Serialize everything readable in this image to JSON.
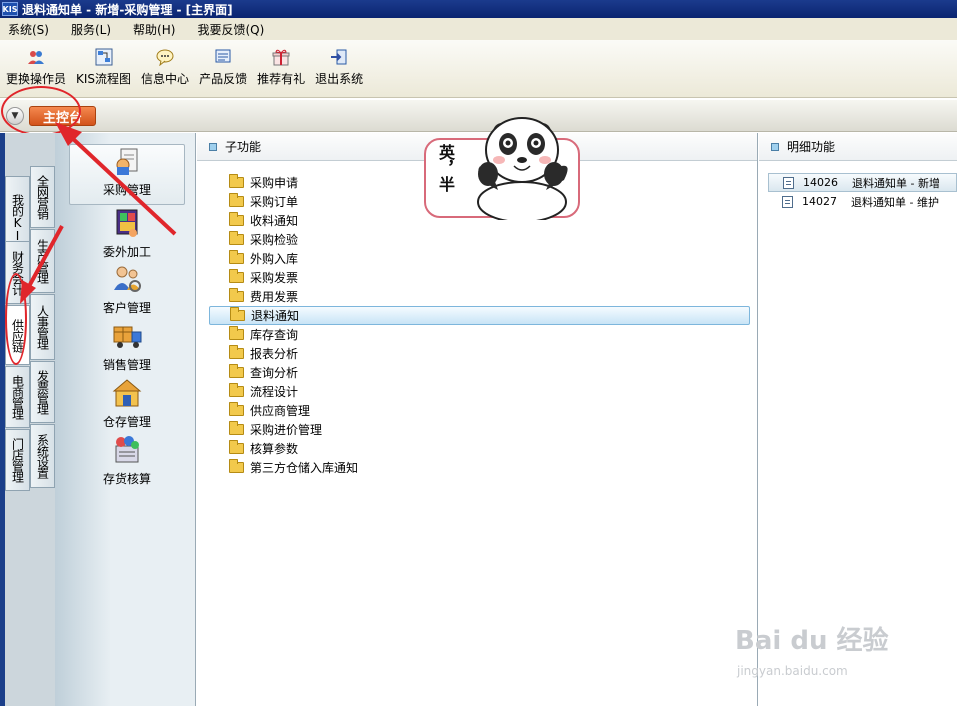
{
  "window": {
    "logo": "KIS",
    "title": "退料通知单 - 新增-采购管理 - [主界面]"
  },
  "menu": [
    "系统(S)",
    "服务(L)",
    "帮助(H)",
    "我要反馈(Q)"
  ],
  "toolbar": [
    {
      "label": "更换操作员",
      "icon": "operator-icon"
    },
    {
      "label": "KIS流程图",
      "icon": "flowchart-icon"
    },
    {
      "label": "信息中心",
      "icon": "message-icon"
    },
    {
      "label": "产品反馈",
      "icon": "feedback-icon"
    },
    {
      "label": "推荐有礼",
      "icon": "gift-icon"
    },
    {
      "label": "退出系统",
      "icon": "exit-icon"
    }
  ],
  "tabs": {
    "main": "主控台"
  },
  "vertical_tabs": [
    {
      "label": "我的KIS"
    },
    {
      "label": "全网营销"
    },
    {
      "label": "财务会计"
    },
    {
      "label": "生产管理"
    },
    {
      "label": "供应链"
    },
    {
      "label": "人事管理"
    },
    {
      "label": "电商管理"
    },
    {
      "label": "发票管理"
    },
    {
      "label": "门店管理"
    },
    {
      "label": "系统设置"
    }
  ],
  "modules": [
    {
      "label": "采购管理",
      "icon": "purchase-icon"
    },
    {
      "label": "委外加工",
      "icon": "outsource-icon"
    },
    {
      "label": "客户管理",
      "icon": "customer-icon"
    },
    {
      "label": "销售管理",
      "icon": "sales-icon"
    },
    {
      "label": "仓存管理",
      "icon": "warehouse-icon"
    },
    {
      "label": "存货核算",
      "icon": "inventory-icon"
    }
  ],
  "sub_panel": {
    "title": "子功能",
    "items": [
      "采购申请",
      "采购订单",
      "收料通知",
      "采购检验",
      "外购入库",
      "采购发票",
      "费用发票",
      "退料通知",
      "库存查询",
      "报表分析",
      "查询分析",
      "流程设计",
      "供应商管理",
      "采购进价管理",
      "核算参数",
      "第三方仓储入库通知"
    ],
    "selected": "退料通知"
  },
  "detail_panel": {
    "title": "明细功能",
    "items": [
      {
        "code": "14026",
        "label": "退料通知单 - 新增"
      },
      {
        "code": "14027",
        "label": "退料通知单 - 维护"
      }
    ]
  },
  "sticker": {
    "text": "英，半"
  },
  "watermark": {
    "brand": "Bai du 经验",
    "url": "jingyan.baidu.com"
  },
  "colors": {
    "title_bar": "#0a2470",
    "main_tab": "#d2521a",
    "annotation": "#e0262b",
    "selection": "#c8e4f6"
  }
}
